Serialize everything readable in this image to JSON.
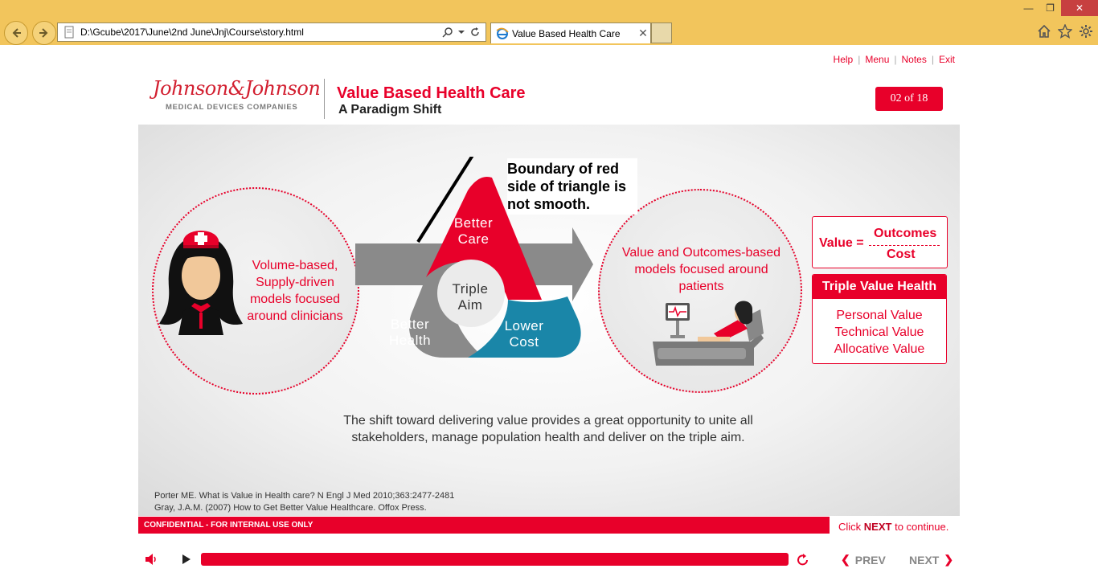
{
  "browser": {
    "url": "D:\\Gcube\\2017\\June\\2nd June\\Jnj\\Course\\story.html",
    "tab_title": "Value Based Health Care",
    "tab_close": "✕",
    "min": "—",
    "max": "❐",
    "close": "✕"
  },
  "header": {
    "links": [
      "Help",
      "Menu",
      "Notes",
      "Exit"
    ],
    "logo_script": "Johnson&Johnson",
    "logo_sub": "MEDICAL DEVICES COMPANIES",
    "title": "Value Based Health Care",
    "subtitle": "A Paradigm Shift",
    "page_indicator": "02 of 18"
  },
  "slide": {
    "left_circle_text": "Volume-based, Supply-driven models focused around clinicians",
    "triangle": {
      "top": "Better Care",
      "center": "Triple Aim",
      "left": "Better Health",
      "right": "Lower Cost"
    },
    "annotation": "Boundary of red side of triangle is not smooth.",
    "right_circle_text": "Value and Outcomes-based models focused around patients",
    "value_box": {
      "label": "Value =",
      "numerator": "Outcomes",
      "denominator": "Cost"
    },
    "triple_value": {
      "heading": "Triple Value Health",
      "items": [
        "Personal Value",
        "Technical Value",
        "Allocative Value"
      ]
    },
    "body_text": "The shift toward delivering value provides a great opportunity to unite all stakeholders, manage population health and deliver on the triple aim.",
    "references": [
      "Porter ME. What is Value in Health care? N Engl J Med 2010;363:2477-2481",
      "Gray, J.A.M. (2007) How to Get Better Value Healthcare. Offox Press."
    ]
  },
  "footer": {
    "confidential": "CONFIDENTIAL - FOR INTERNAL USE ONLY",
    "click_prefix": "Click",
    "click_next": "NEXT",
    "click_suffix": "to continue.",
    "prev": "PREV",
    "next": "NEXT"
  },
  "colors": {
    "accent": "#e8002a",
    "teal": "#1a86a8",
    "gray": "#8a8a8a",
    "chrome": "#f2c55c"
  }
}
